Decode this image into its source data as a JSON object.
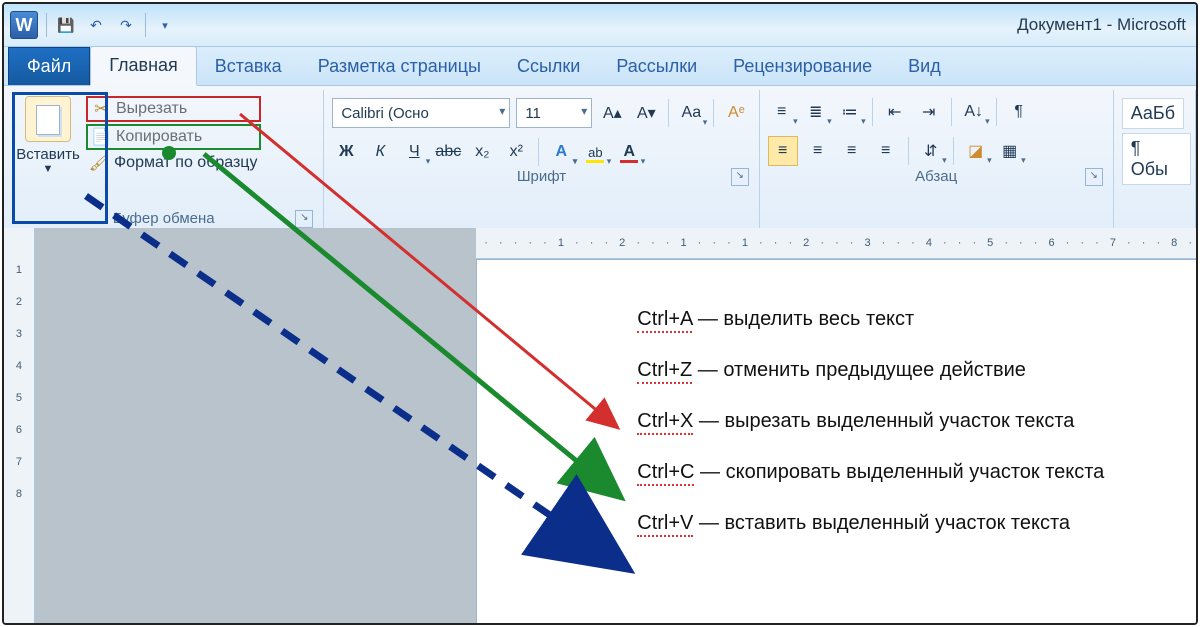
{
  "title": "Документ1 - Microsoft",
  "tabs": {
    "file": "Файл",
    "home": "Главная",
    "insert": "Вставка",
    "layout": "Разметка страницы",
    "refs": "Ссылки",
    "mail": "Рассылки",
    "review": "Рецензирование",
    "view": "Вид"
  },
  "ribbon": {
    "clipboard": {
      "paste": "Вставить",
      "cut": "Вырезать",
      "copy": "Копировать",
      "format": "Формат по образцу",
      "group": "Буфер обмена"
    },
    "font": {
      "name": "Calibri (Осно",
      "size": "11",
      "group": "Шрифт"
    },
    "paragraph": {
      "group": "Абзац"
    },
    "styles": {
      "item1": "АаБб",
      "item2": "¶ Обы"
    }
  },
  "hruler": "· · · · · 1 · · · 2 · · · 1 · · · 1 · · · 2 · · · 3 · · · 4 · · · 5 · · · 6 · · · 7 · · · 8 ·",
  "doc": {
    "l1k": "Ctrl+A",
    "l1t": " — выделить весь текст",
    "l2k": "Ctrl+Z",
    "l2t": " — отменить предыдущее действие",
    "l3k": "Ctrl+X",
    "l3t": " — вырезать выделенный участок текста",
    "l4k": "Ctrl+C",
    "l4t": " — скопировать выделенный участок текста",
    "l5k": "Ctrl+V",
    "l5t": " — вставить выделенный участок текста"
  }
}
